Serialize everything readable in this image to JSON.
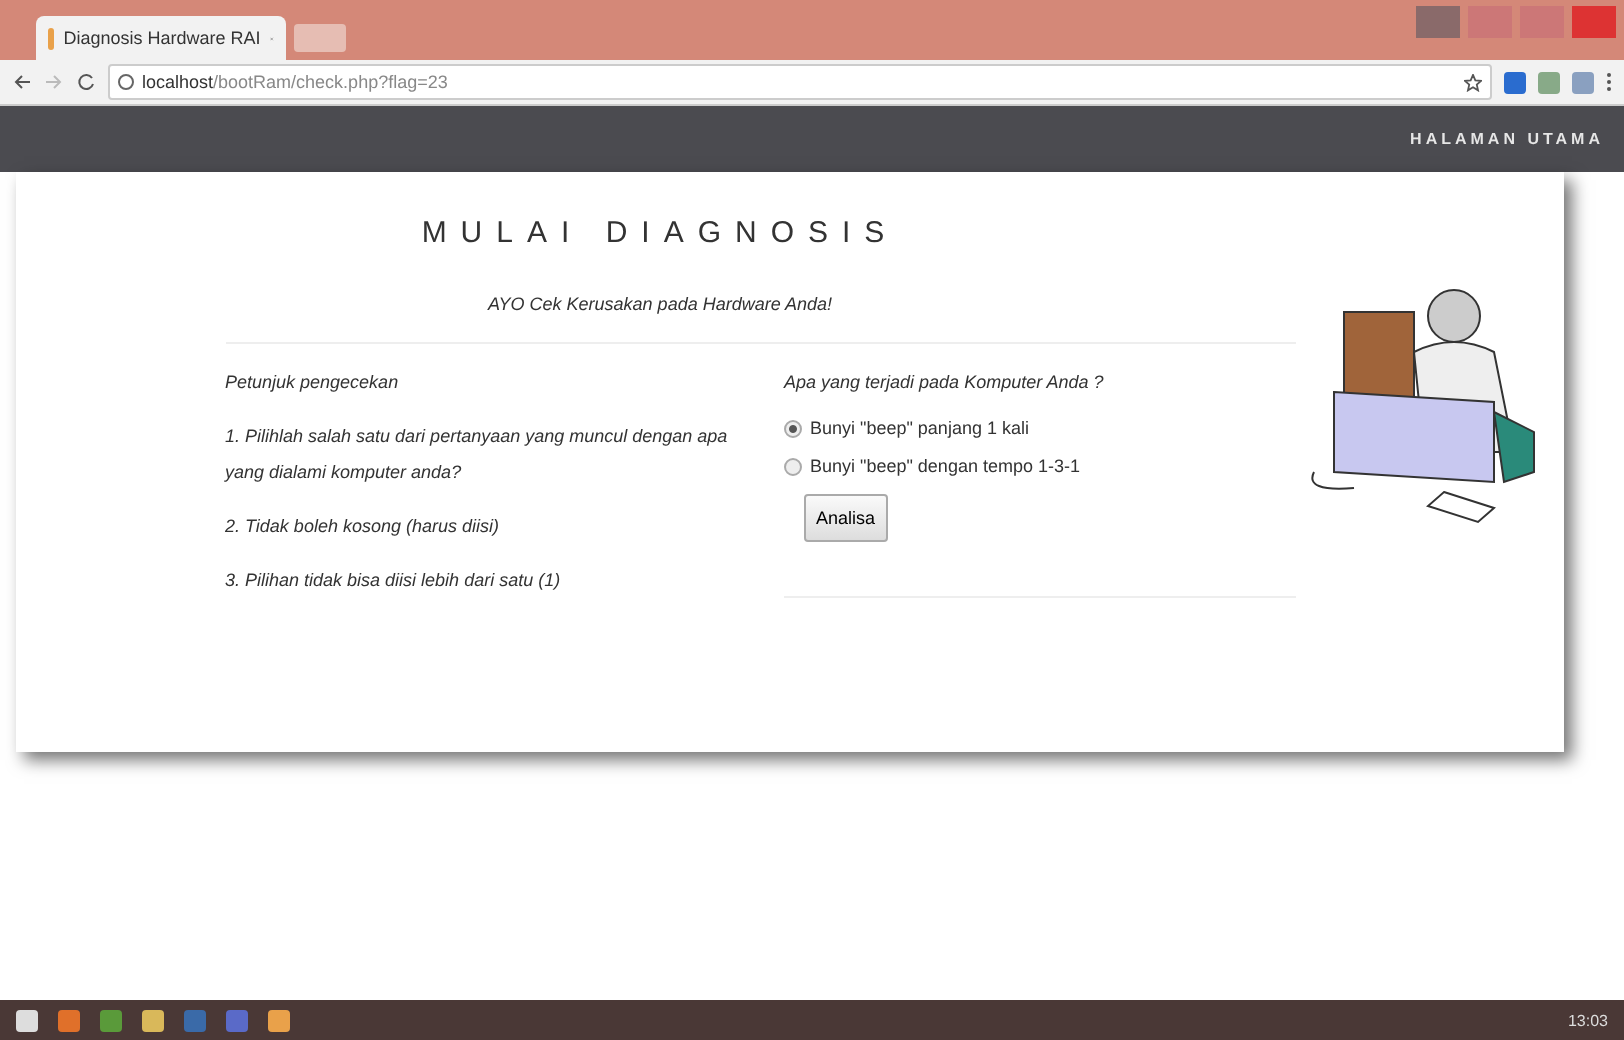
{
  "browser": {
    "tab_title": "Diagnosis Hardware RAI",
    "url_host": "localhost",
    "url_path": "/bootRam/check.php?flag=23"
  },
  "nav": {
    "link": "HALAMAN UTAMA"
  },
  "page": {
    "title": "MULAI DIAGNOSIS",
    "subtitle": "AYO Cek Kerusakan pada Hardware Anda!",
    "instructions": {
      "heading": "Petunjuk pengecekan",
      "items": [
        "1. Pilihlah salah satu dari pertanyaan yang muncul dengan apa yang dialami komputer anda?",
        "2. Tidak boleh kosong (harus diisi)",
        "3. Pilihan tidak bisa diisi lebih dari satu (1)"
      ]
    },
    "question": {
      "heading": "Apa yang terjadi pada Komputer Anda ?",
      "options": [
        {
          "label": "Bunyi \"beep\" panjang 1 kali",
          "selected": true
        },
        {
          "label": "Bunyi \"beep\" dengan tempo 1-3-1",
          "selected": false
        }
      ],
      "button": "Analisa"
    }
  },
  "taskbar": {
    "clock": "13:03"
  }
}
